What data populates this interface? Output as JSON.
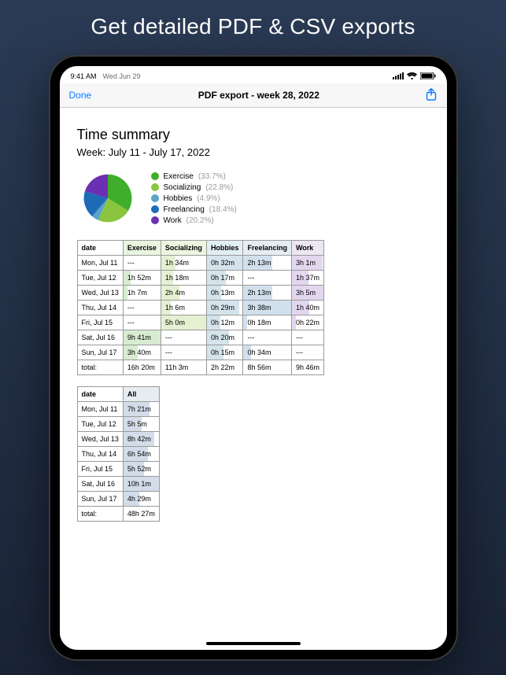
{
  "promo_headline": "Get detailed PDF & CSV exports",
  "statusbar": {
    "time": "9:41 AM",
    "date": "Wed Jun 29"
  },
  "navbar": {
    "done": "Done",
    "title": "PDF export - week 28, 2022"
  },
  "doc": {
    "heading": "Time summary",
    "subheading": "Week: July 11 - July 17, 2022"
  },
  "legend": [
    {
      "name": "Exercise",
      "pct": "(33.7%)",
      "color": "#3fae2a"
    },
    {
      "name": "Socializing",
      "pct": "(22.8%)",
      "color": "#8bc53f"
    },
    {
      "name": "Hobbies",
      "pct": "(4.9%)",
      "color": "#5aa6c4"
    },
    {
      "name": "Freelancing",
      "pct": "(18.4%)",
      "color": "#1e6bb8"
    },
    {
      "name": "Work",
      "pct": "(20.2%)",
      "color": "#6b2fb3"
    }
  ],
  "table1": {
    "headers": [
      "date",
      "Exercise",
      "Socializing",
      "Hobbies",
      "Freelancing",
      "Work"
    ],
    "rows": [
      [
        "Mon, Jul 11",
        "---",
        "1h 34m",
        "0h 32m",
        "2h 13m",
        "3h 1m"
      ],
      [
        "Tue, Jul 12",
        "1h 52m",
        "1h 18m",
        "0h 17m",
        "---",
        "1h 37m"
      ],
      [
        "Wed, Jul 13",
        "1h 7m",
        "2h 4m",
        "0h 13m",
        "2h 13m",
        "3h 5m"
      ],
      [
        "Thu, Jul 14",
        "---",
        "1h 6m",
        "0h 29m",
        "3h 38m",
        "1h 40m"
      ],
      [
        "Fri, Jul 15",
        "---",
        "5h 0m",
        "0h 12m",
        "0h 18m",
        "0h 22m"
      ],
      [
        "Sat, Jul 16",
        "9h 41m",
        "---",
        "0h 20m",
        "---",
        "---"
      ],
      [
        "Sun, Jul 17",
        "3h 40m",
        "---",
        "0h 15m",
        "0h 34m",
        "---"
      ],
      [
        "total:",
        "16h 20m",
        "11h 3m",
        "2h 22m",
        "8h 56m",
        "9h 46m"
      ]
    ]
  },
  "table2": {
    "headers": [
      "date",
      "All"
    ],
    "rows": [
      [
        "Mon, Jul 11",
        "7h 21m"
      ],
      [
        "Tue, Jul 12",
        "5h 5m"
      ],
      [
        "Wed, Jul 13",
        "8h 42m"
      ],
      [
        "Thu, Jul 14",
        "6h 54m"
      ],
      [
        "Fri, Jul 15",
        "5h 52m"
      ],
      [
        "Sat, Jul 16",
        "10h 1m"
      ],
      [
        "Sun, Jul 17",
        "4h 29m"
      ],
      [
        "total:",
        "48h 27m"
      ]
    ]
  },
  "chart_data": {
    "type": "pie",
    "title": "Time summary",
    "series": [
      {
        "name": "Exercise",
        "value": 33.7,
        "color": "#3fae2a"
      },
      {
        "name": "Socializing",
        "value": 22.8,
        "color": "#8bc53f"
      },
      {
        "name": "Hobbies",
        "value": 4.9,
        "color": "#5aa6c4"
      },
      {
        "name": "Freelancing",
        "value": 18.4,
        "color": "#1e6bb8"
      },
      {
        "name": "Work",
        "value": 20.2,
        "color": "#6b2fb3"
      }
    ]
  }
}
